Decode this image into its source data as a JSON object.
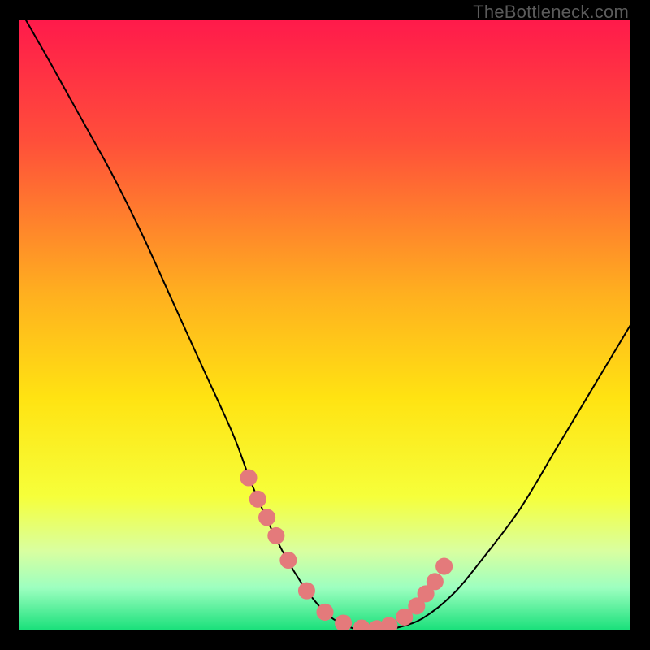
{
  "watermark": "TheBottleneck.com",
  "chart_data": {
    "type": "line",
    "title": "",
    "xlabel": "",
    "ylabel": "",
    "xlim": [
      0,
      100
    ],
    "ylim": [
      0,
      100
    ],
    "grid": false,
    "legend": false,
    "background_gradient": {
      "stops": [
        {
          "offset": 0.0,
          "color": "#ff1a4b"
        },
        {
          "offset": 0.2,
          "color": "#ff4f3a"
        },
        {
          "offset": 0.45,
          "color": "#ffb01f"
        },
        {
          "offset": 0.62,
          "color": "#ffe312"
        },
        {
          "offset": 0.78,
          "color": "#f6ff3a"
        },
        {
          "offset": 0.87,
          "color": "#d9ffa0"
        },
        {
          "offset": 0.93,
          "color": "#9dffc0"
        },
        {
          "offset": 1.0,
          "color": "#18e07a"
        }
      ]
    },
    "series": [
      {
        "name": "bottleneck-curve",
        "color": "#000000",
        "x": [
          1,
          5,
          10,
          15,
          20,
          25,
          30,
          35,
          38,
          42,
          46,
          50,
          53,
          56,
          59,
          62,
          66,
          71,
          76,
          82,
          88,
          94,
          100
        ],
        "y": [
          100,
          93,
          84,
          75,
          65,
          54,
          43,
          32,
          24,
          15,
          8,
          3,
          1,
          0,
          0,
          0.5,
          2,
          6,
          12,
          20,
          30,
          40,
          50
        ]
      }
    ],
    "marker_points": {
      "name": "highlight-dots",
      "color": "#e47a7b",
      "radius_pct": 1.4,
      "x": [
        37.5,
        39.0,
        40.5,
        42.0,
        44.0,
        47.0,
        50.0,
        53.0,
        56.0,
        58.5,
        60.5,
        63.0,
        65.0,
        66.5,
        68.0,
        69.5
      ],
      "y": [
        25.0,
        21.5,
        18.5,
        15.5,
        11.5,
        6.5,
        3.0,
        1.2,
        0.4,
        0.3,
        0.8,
        2.2,
        4.0,
        6.0,
        8.0,
        10.5
      ]
    }
  }
}
